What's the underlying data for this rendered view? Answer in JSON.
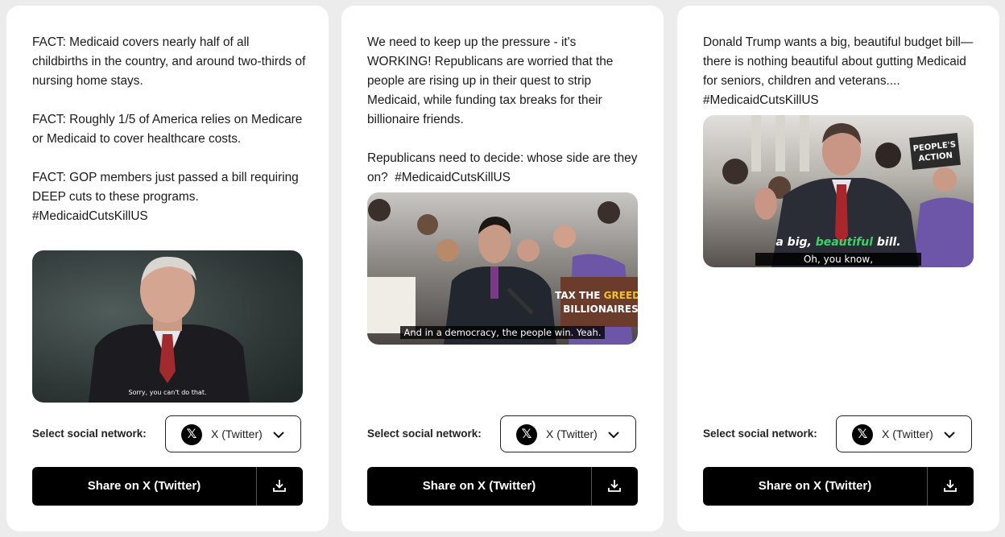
{
  "cards": [
    {
      "post_text": "FACT: Medicaid covers nearly half of all childbirths in the country, and around two-thirds of nursing home stays.\n\nFACT: Roughly 1/5 of America relies on Medicare or Medicaid to cover healthcare costs.\n\nFACT: GOP members just passed a bill requiring DEEP cuts to these programs.\n#MedicaidCutsKillUS",
      "video_caption": "Sorry, you can't do that.",
      "select_label": "Select social network:",
      "selected_network": "X (Twitter)",
      "share_label": "Share on X (Twitter)"
    },
    {
      "post_text": "We need to keep up the pressure - it's WORKING! Republicans are worried that the people are rising up in their quest to strip Medicaid, while funding tax breaks for their billionaire friends.\n\nRepublicans need to decide: whose side are they on?  #MedicaidCutsKillUS",
      "video_caption": "And in a democracy, the people win. Yeah.",
      "sign_text": "TAX THE GREEDY BILLIONAIRES",
      "select_label": "Select social network:",
      "selected_network": "X (Twitter)",
      "share_label": "Share on X (Twitter)"
    },
    {
      "post_text": "Donald Trump wants a big, beautiful budget bill—there is nothing beautiful about gutting Medicaid for seniors, children and veterans.... #MedicaidCutsKillUS",
      "video_caption_top_1": "a big,",
      "video_caption_top_2": "beautiful",
      "video_caption_top_3": "bill.",
      "video_caption": "Oh, you know,",
      "sign_text": "PEOPLE'S ACTION",
      "select_label": "Select social network:",
      "selected_network": "X (Twitter)",
      "share_label": "Share on X (Twitter)"
    }
  ],
  "icons": {
    "x_logo": "x-logo-icon",
    "chevron": "chevron-down-icon",
    "download": "download-icon"
  },
  "colors": {
    "button_bg": "#000000",
    "card_bg": "#ffffff",
    "page_bg": "#ececed",
    "caption_highlight": "#3ed16a"
  }
}
